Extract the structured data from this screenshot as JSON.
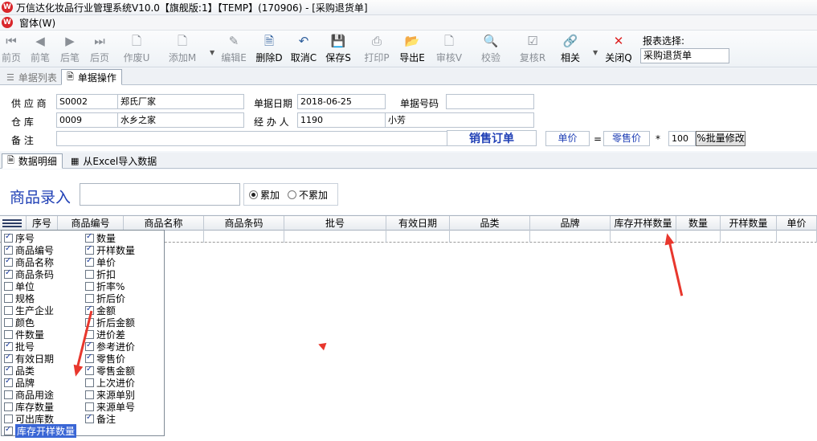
{
  "window": {
    "title": "万信达化妆品行业管理系统V10.0【旗舰版:1】【TEMP】(170906) - [采购退货单]"
  },
  "menubar": {
    "items": [
      {
        "label": "窗体(W)"
      }
    ]
  },
  "toolbar": {
    "buttons": [
      {
        "label": "前页",
        "icon": "double-left-arrow-icon",
        "glyph": "⏮",
        "enabled": false
      },
      {
        "label": "前笔",
        "icon": "left-arrow-icon",
        "glyph": "◀",
        "enabled": false
      },
      {
        "label": "后笔",
        "icon": "right-arrow-icon",
        "glyph": "▶",
        "enabled": false
      },
      {
        "label": "后页",
        "icon": "double-right-arrow-icon",
        "glyph": "⏭",
        "enabled": false
      },
      {
        "label": "作废U",
        "icon": "void-document-icon",
        "glyph": "🗋",
        "enabled": false
      },
      {
        "label": "添加M",
        "icon": "add-document-icon",
        "glyph": "🗋",
        "enabled": false
      },
      {
        "label": "编辑E",
        "icon": "edit-icon",
        "glyph": "✎",
        "enabled": false
      },
      {
        "label": "删除D",
        "icon": "delete-document-icon",
        "glyph": "🗎",
        "enabled": true
      },
      {
        "label": "取消C",
        "icon": "undo-icon",
        "glyph": "↶",
        "enabled": true
      },
      {
        "label": "保存S",
        "icon": "save-icon",
        "glyph": "💾",
        "enabled": true
      },
      {
        "label": "打印P",
        "icon": "printer-icon",
        "glyph": "⎙",
        "enabled": false
      },
      {
        "label": "导出E",
        "icon": "export-folder-icon",
        "glyph": "📂",
        "enabled": true
      },
      {
        "label": "审核V",
        "icon": "approve-icon",
        "glyph": "🗋",
        "enabled": false
      },
      {
        "label": "校验",
        "icon": "verify-icon",
        "glyph": "🔍",
        "enabled": false
      },
      {
        "label": "复核R",
        "icon": "recheck-icon",
        "glyph": "☑",
        "enabled": false
      },
      {
        "label": "相关",
        "icon": "link-icon",
        "glyph": "🔗",
        "enabled": true
      },
      {
        "label": "关闭Q",
        "icon": "close-icon",
        "glyph": "✕",
        "enabled": true
      }
    ],
    "report_label": "报表选择:",
    "report_value": "采购退货单"
  },
  "main_tabs": [
    {
      "label": "单据列表",
      "active": false
    },
    {
      "label": "单据操作",
      "active": true
    }
  ],
  "form": {
    "supplier_label": "供 应 商",
    "supplier_code": "S0002",
    "supplier_name": "郑氏厂家",
    "date_label": "单据日期",
    "date_value": "2018-06-25",
    "docno_label": "单据号码",
    "docno_value": "",
    "warehouse_label": "仓    库",
    "warehouse_code": "0009",
    "warehouse_name": "水乡之家",
    "handler_label": "经 办 人",
    "handler_code": "1190",
    "handler_name": "小芳",
    "note_label": "备    注",
    "note_value": "",
    "sale_order_title": "销售订单",
    "price_label": "单价",
    "equals": "=",
    "price_type": "零售价",
    "multiply": "*",
    "factor": "100",
    "batch_button": "%批量修改"
  },
  "detail_tabs": [
    {
      "label": "数据明细",
      "active": true
    },
    {
      "label": "从Excel导入数据",
      "active": false
    }
  ],
  "entry": {
    "label": "商品录入",
    "input_value": "",
    "radio_accumulate": "累加",
    "radio_no_accumulate": "不累加",
    "selected": "accumulate"
  },
  "grid": {
    "columns": [
      "序号",
      "商品编号",
      "商品名称",
      "商品条码",
      "批号",
      "有效日期",
      "品类",
      "品牌",
      "库存开样数量",
      "数量",
      "开样数量",
      "单价"
    ]
  },
  "column_chooser": {
    "left": [
      {
        "label": "序号",
        "checked": true
      },
      {
        "label": "商品编号",
        "checked": true
      },
      {
        "label": "商品名称",
        "checked": true
      },
      {
        "label": "商品条码",
        "checked": true
      },
      {
        "label": "单位",
        "checked": false
      },
      {
        "label": "规格",
        "checked": false
      },
      {
        "label": "生产企业",
        "checked": false
      },
      {
        "label": "颜色",
        "checked": false
      },
      {
        "label": "件数量",
        "checked": false
      },
      {
        "label": "批号",
        "checked": true
      },
      {
        "label": "有效日期",
        "checked": true
      },
      {
        "label": "品类",
        "checked": true
      },
      {
        "label": "品牌",
        "checked": true
      },
      {
        "label": "商品用途",
        "checked": false
      },
      {
        "label": "库存数量",
        "checked": false
      },
      {
        "label": "可出库数",
        "checked": false
      },
      {
        "label": "库存开样数量",
        "checked": true,
        "highlighted": true
      }
    ],
    "right": [
      {
        "label": "数量",
        "checked": true
      },
      {
        "label": "开样数量",
        "checked": true
      },
      {
        "label": "单价",
        "checked": true
      },
      {
        "label": "折扣",
        "checked": false
      },
      {
        "label": "折率%",
        "checked": false
      },
      {
        "label": "折后价",
        "checked": false
      },
      {
        "label": "金额",
        "checked": true
      },
      {
        "label": "折后金额",
        "checked": false
      },
      {
        "label": "进价差",
        "checked": false
      },
      {
        "label": "参考进价",
        "checked": true
      },
      {
        "label": "零售价",
        "checked": true
      },
      {
        "label": "零售金额",
        "checked": true
      },
      {
        "label": "上次进价",
        "checked": false
      },
      {
        "label": "来源单别",
        "checked": false
      },
      {
        "label": "来源单号",
        "checked": false
      },
      {
        "label": "备注",
        "checked": true
      }
    ]
  },
  "colors": {
    "accent": "#1f3fb5",
    "highlight": "#3a66d5",
    "annotation": "#e8372d"
  }
}
